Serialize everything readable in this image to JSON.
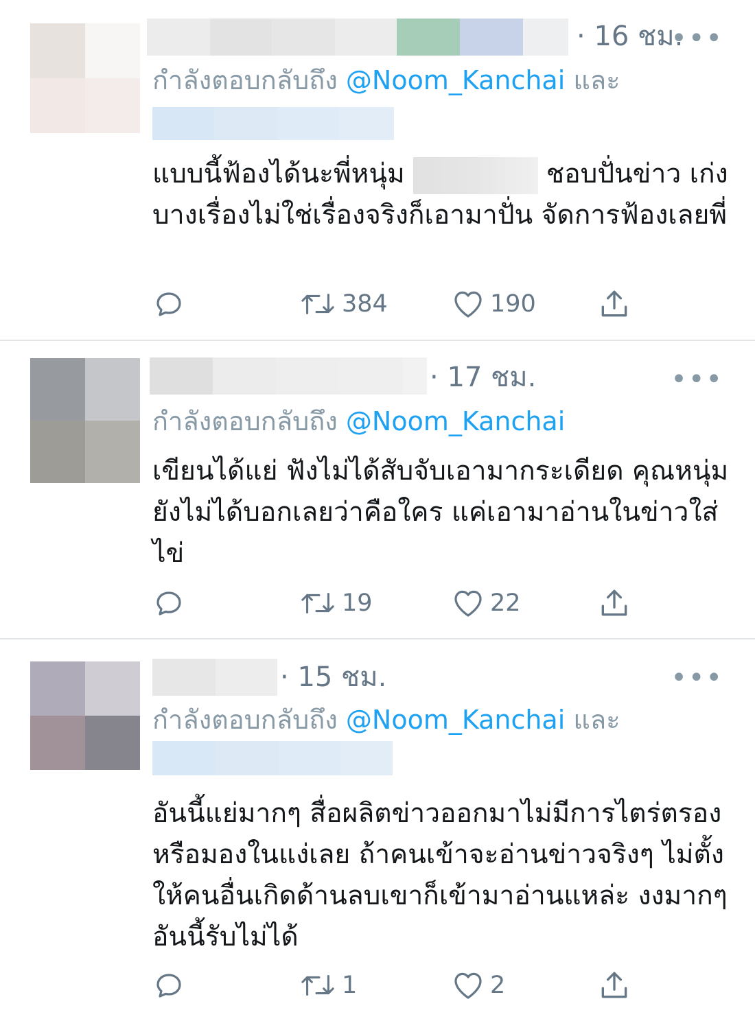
{
  "tweets": [
    {
      "time": "16 ชม.",
      "reply_prefix": "กำลังตอบกลับถึง",
      "mention": "@Noom_Kanchai",
      "mention_suffix": "และ",
      "text_1": "แบบนี้ฟ้องได้นะพี่หนุ่ม",
      "text_2": "ชอบปั่นข่าว เก่งบางเรื่องไม่ใช่เรื่องจริงก็เอามาปั่น  จัดการฟ้องเลยพี่",
      "retweets": "384",
      "likes": "190",
      "more": "•••"
    },
    {
      "time": "17 ชม.",
      "reply_prefix": "กำลังตอบกลับถึง",
      "mention": "@Noom_Kanchai",
      "text": "เขียนได้แย่ ฟังไม่ได้สับจับเอามากระเดียด คุณหนุ่มยังไม่ได้บอกเลยว่าคือใคร แค่เอามาอ่านในข่าวใส่ไข่",
      "retweets": "19",
      "likes": "22",
      "more": "•••"
    },
    {
      "time": "15 ชม.",
      "reply_prefix": "กำลังตอบกลับถึง",
      "mention": "@Noom_Kanchai",
      "mention_suffix": "และ",
      "text": "อันนี้แย่มากๆ สื่อผลิตข่าวออกมาไม่มีการไตร่ตรอง หรือมองในแง่เลย ถ้าคนเข้าจะอ่านข่าวจริงๆ ไม่ตั้งให้คนอื่นเกิดด้านลบเขาก็เข้ามาอ่านแหล่ะ งงมากๆ อันนี้รับไม่ได้",
      "retweets": "1",
      "likes": "2",
      "more": "•••"
    }
  ],
  "icons": {
    "reply": "reply-icon",
    "retweet": "retweet-icon",
    "like": "heart-icon",
    "share": "share-icon"
  },
  "colors": {
    "mention": "#1da1f2",
    "meta": "#657786",
    "divider": "#e3e6e8"
  }
}
